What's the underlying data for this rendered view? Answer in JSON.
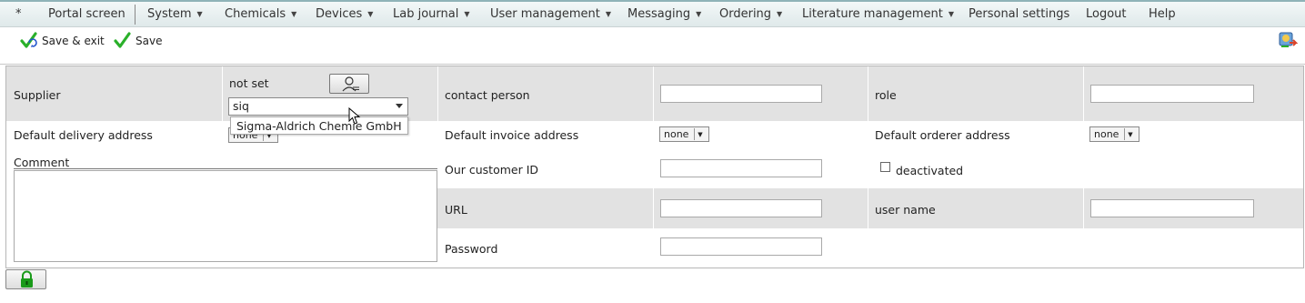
{
  "menu": {
    "star": "*",
    "items": [
      {
        "label": "Portal screen",
        "has_dropdown": false
      },
      {
        "label": "System",
        "has_dropdown": true
      },
      {
        "label": "Chemicals",
        "has_dropdown": true
      },
      {
        "label": "Devices",
        "has_dropdown": true
      },
      {
        "label": "Lab journal",
        "has_dropdown": true
      },
      {
        "label": "User management",
        "has_dropdown": true
      },
      {
        "label": "Messaging",
        "has_dropdown": true
      },
      {
        "label": "Ordering",
        "has_dropdown": true
      },
      {
        "label": "Literature management",
        "has_dropdown": true
      },
      {
        "label": "Personal settings",
        "has_dropdown": false
      },
      {
        "label": "Logout",
        "has_dropdown": false
      },
      {
        "label": "Help",
        "has_dropdown": false
      }
    ],
    "dropdown_arrow": "▼"
  },
  "toolbar": {
    "save_exit_label": "Save & exit",
    "save_label": "Save",
    "checkmark_color": "#2ab02a"
  },
  "form": {
    "supplier_label": "Supplier",
    "supplier_value": "not set",
    "supplier_search_value": "siq",
    "supplier_suggestion": "Sigma-Aldrich Chemie GmbH",
    "contact_person_label": "contact person",
    "contact_person_value": "",
    "role_label": "role",
    "role_value": "",
    "default_delivery_label": "Default delivery address",
    "default_delivery_value": "none",
    "default_invoice_label": "Default invoice address",
    "default_invoice_value": "none",
    "default_orderer_label": "Default orderer address",
    "default_orderer_value": "none",
    "comment_label": "Comment",
    "comment_value": "",
    "customer_id_label": "Our customer ID",
    "customer_id_value": "",
    "deactivated_label": "deactivated",
    "deactivated_checked": false,
    "url_label": "URL",
    "url_value": "",
    "username_label": "user name",
    "username_value": "",
    "password_label": "Password",
    "password_value": ""
  },
  "colors": {
    "row_shade": "#e2e2e2",
    "menu_bg": "#e6eeef",
    "lock_green": "#1a9a1a"
  }
}
